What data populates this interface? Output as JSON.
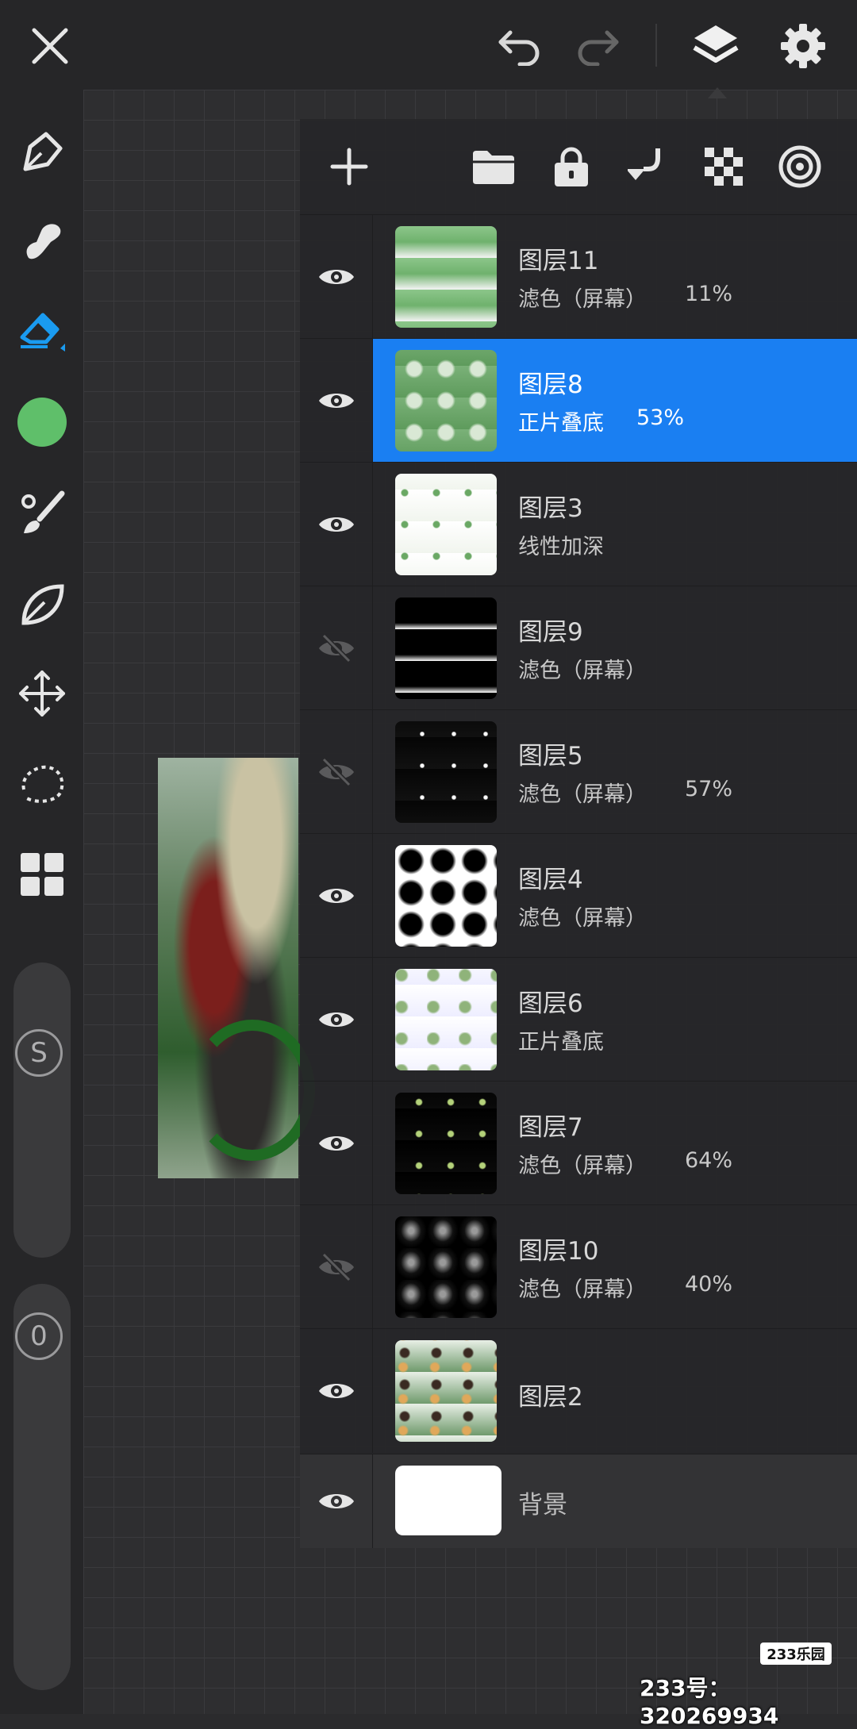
{
  "toolbar": {
    "close_icon": "close-icon",
    "undo_icon": "undo-icon",
    "redo_icon": "redo-icon",
    "layers_icon": "layers-icon",
    "settings_icon": "gear-icon"
  },
  "sidebar": {
    "brush_size_label": "S",
    "opacity_label": "0",
    "current_color": "#5fbf6a"
  },
  "layers_panel": {
    "actions": [
      "add-layer",
      "folder",
      "lock",
      "merge-down",
      "transparency",
      "target"
    ],
    "layers": [
      {
        "name": "图层11",
        "mode": "滤色（屏幕）",
        "opacity": "11%",
        "visible": true,
        "selected": false
      },
      {
        "name": "图层8",
        "mode": "正片叠底",
        "opacity": "53%",
        "visible": true,
        "selected": true
      },
      {
        "name": "图层3",
        "mode": "线性加深",
        "opacity": "",
        "visible": true,
        "selected": false
      },
      {
        "name": "图层9",
        "mode": "滤色（屏幕）",
        "opacity": "",
        "visible": false,
        "selected": false
      },
      {
        "name": "图层5",
        "mode": "滤色（屏幕）",
        "opacity": "57%",
        "visible": false,
        "selected": false
      },
      {
        "name": "图层4",
        "mode": "滤色（屏幕）",
        "opacity": "",
        "visible": true,
        "selected": false
      },
      {
        "name": "图层6",
        "mode": "正片叠底",
        "opacity": "",
        "visible": true,
        "selected": false
      },
      {
        "name": "图层7",
        "mode": "滤色（屏幕）",
        "opacity": "64%",
        "visible": true,
        "selected": false
      },
      {
        "name": "图层10",
        "mode": "滤色（屏幕）",
        "opacity": "40%",
        "visible": false,
        "selected": false
      },
      {
        "name": "图层2",
        "mode": "",
        "opacity": "",
        "visible": true,
        "selected": false
      }
    ],
    "background_label": "背景"
  },
  "watermark": {
    "logo": "233乐园",
    "text": "233号：320269934"
  }
}
